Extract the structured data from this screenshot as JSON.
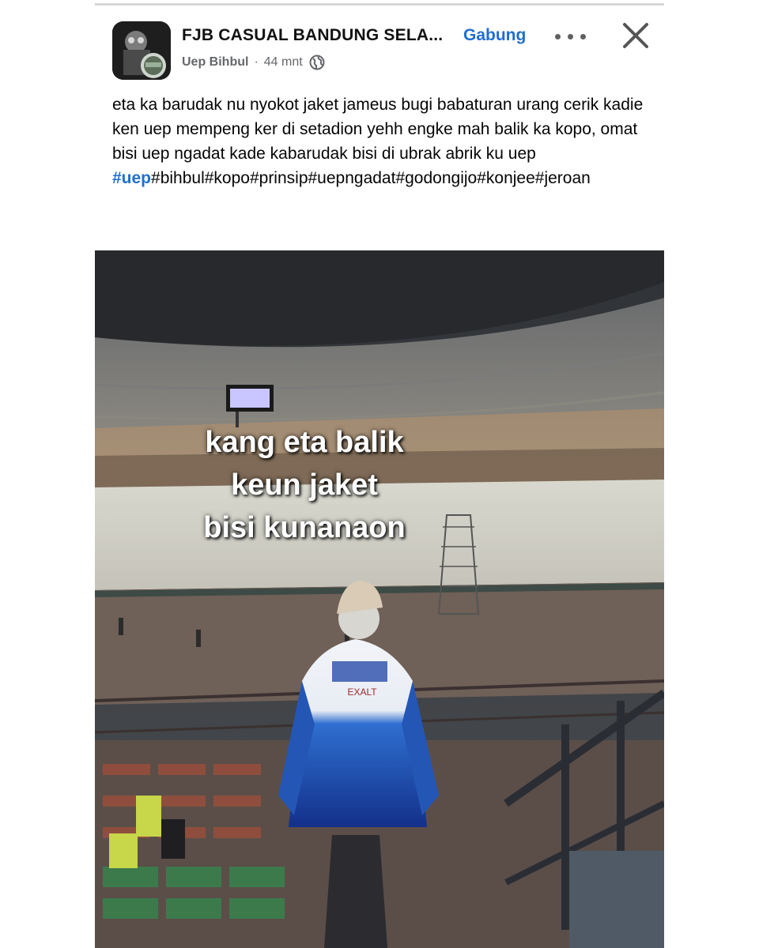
{
  "post": {
    "group_name": "FJB CASUAL BANDUNG SELA...",
    "join_label": "Gabung",
    "author": "Uep Bihbul",
    "separator": "·",
    "time": "44 mnt",
    "privacy_icon": "globe-icon",
    "body": "eta ka barudak nu nyokot jaket jameus bugi babaturan urang cerik kadie ken uep mempeng ker di setadion yehh engke mah balik ka kopo, omat bisi uep ngadat kade kabarudak bisi di ubrak abrik ku uep",
    "hashtag_first": "#uep",
    "hashtags_rest": "#bihbul#kopo#prinsip#uepngadat#godongijo#konjee#jeroan"
  },
  "photo": {
    "caption_lines": [
      "kang eta balik",
      "keun jaket",
      "bisi kunanaon"
    ],
    "jacket_print": "EXALT"
  },
  "colors": {
    "accent": "#1f6fd1",
    "meta_gray": "#65676b",
    "jacket_blue": "#1c4fb0"
  }
}
